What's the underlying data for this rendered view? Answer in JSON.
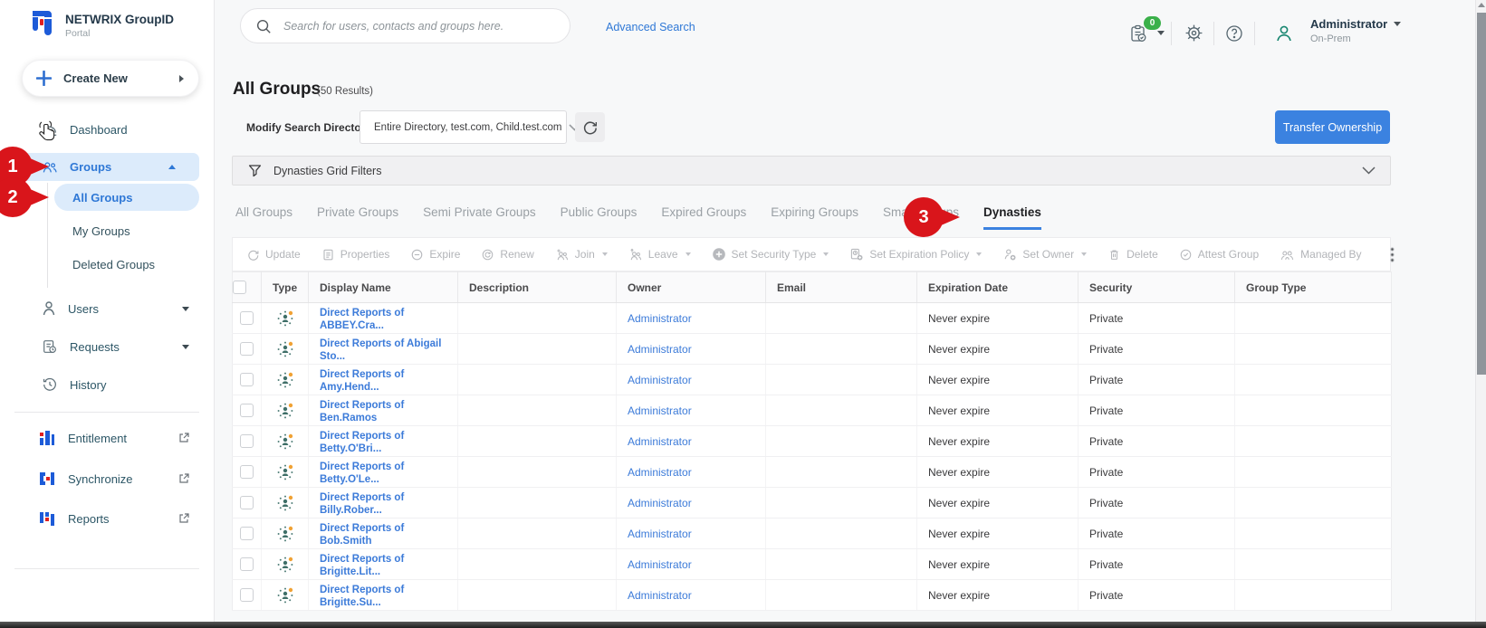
{
  "brand": {
    "title": "NETWRIX GroupID",
    "subtitle": "Portal"
  },
  "sidebar": {
    "create_new": "Create New",
    "items": {
      "dashboard": "Dashboard",
      "groups": "Groups",
      "all_groups": "All Groups",
      "my_groups": "My Groups",
      "deleted_groups": "Deleted Groups",
      "users": "Users",
      "requests": "Requests",
      "history": "History",
      "entitlement": "Entitlement",
      "synchronize": "Synchronize",
      "reports": "Reports"
    }
  },
  "topbar": {
    "search_placeholder": "Search for users, contacts and groups here.",
    "advanced_search": "Advanced Search",
    "notification_count": "0",
    "user_name": "Administrator",
    "user_env": "On-Prem"
  },
  "page": {
    "title": "All Groups",
    "result_count": "(50 Results)",
    "modify_search_label": "Modify Search Directory:",
    "directory_value": "Entire Directory, test.com, Child.test.com",
    "transfer_ownership": "Transfer Ownership",
    "grid_filters_label": "Dynasties Grid Filters"
  },
  "tabs": [
    {
      "label": "All Groups"
    },
    {
      "label": "Private Groups"
    },
    {
      "label": "Semi Private Groups"
    },
    {
      "label": "Public Groups"
    },
    {
      "label": "Expired Groups"
    },
    {
      "label": "Expiring Groups"
    },
    {
      "label": "Smart Groups"
    },
    {
      "label": "Dynasties",
      "active": true
    }
  ],
  "toolbar": {
    "items": [
      {
        "label": "Update"
      },
      {
        "label": "Properties"
      },
      {
        "label": "Expire"
      },
      {
        "label": "Renew"
      },
      {
        "label": "Join",
        "caret": true
      },
      {
        "label": "Leave",
        "caret": true
      },
      {
        "label": "Set Security Type",
        "caret": true
      },
      {
        "label": "Set Expiration Policy",
        "caret": true
      },
      {
        "label": "Set Owner",
        "caret": true
      },
      {
        "label": "Delete"
      },
      {
        "label": "Attest Group"
      },
      {
        "label": "Managed By"
      }
    ]
  },
  "table": {
    "columns": [
      "Type",
      "Display Name",
      "Description",
      "Owner",
      "Email",
      "Expiration Date",
      "Security",
      "Group Type"
    ],
    "rows": [
      {
        "name": "Direct Reports of ABBEY.Cra...",
        "owner": "Administrator",
        "expiration": "Never expire",
        "security": "Private"
      },
      {
        "name": "Direct Reports of Abigail Sto...",
        "owner": "Administrator",
        "expiration": "Never expire",
        "security": "Private"
      },
      {
        "name": "Direct Reports of Amy.Hend...",
        "owner": "Administrator",
        "expiration": "Never expire",
        "security": "Private"
      },
      {
        "name": "Direct Reports of Ben.Ramos",
        "owner": "Administrator",
        "expiration": "Never expire",
        "security": "Private"
      },
      {
        "name": "Direct Reports of Betty.O'Bri...",
        "owner": "Administrator",
        "expiration": "Never expire",
        "security": "Private"
      },
      {
        "name": "Direct Reports of Betty.O'Le...",
        "owner": "Administrator",
        "expiration": "Never expire",
        "security": "Private"
      },
      {
        "name": "Direct Reports of Billy.Rober...",
        "owner": "Administrator",
        "expiration": "Never expire",
        "security": "Private"
      },
      {
        "name": "Direct Reports of Bob.Smith",
        "owner": "Administrator",
        "expiration": "Never expire",
        "security": "Private"
      },
      {
        "name": "Direct Reports of Brigitte.Lit...",
        "owner": "Administrator",
        "expiration": "Never expire",
        "security": "Private"
      },
      {
        "name": "Direct Reports of Brigitte.Su...",
        "owner": "Administrator",
        "expiration": "Never expire",
        "security": "Private"
      }
    ]
  },
  "annotations": {
    "markers": [
      "1",
      "2",
      "3"
    ]
  },
  "colors": {
    "accent_blue": "#3b82e0",
    "link_blue": "#3c7bd9",
    "sidebar_active_text": "#2f78d6",
    "sidebar_active_bg": "#dcebfb",
    "marker_red": "#d9151b",
    "badge_green": "#3ab04a",
    "user_icon_teal": "#16856f",
    "dynasty_icon_teal": "#4f7d77",
    "dynasty_icon_orange": "#f0a235"
  }
}
